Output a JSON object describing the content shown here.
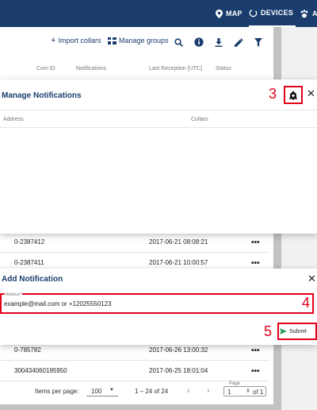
{
  "nav": {
    "map_label": "MAP",
    "devices_label": "DEVICES",
    "partial_label": "A"
  },
  "toolbar": {
    "import_label": "Import collars",
    "manage_groups_label": "Manage groups"
  },
  "table": {
    "columns": [
      "Com ID",
      "Notifications",
      "Last Reception [UTC]",
      "Status"
    ],
    "rows": [
      {
        "com_id": "0-2387412",
        "last_reception": "2017-06-21 08:08:21"
      },
      {
        "com_id": "0-2387411",
        "last_reception": "2017-06-21 10:00:57"
      },
      {
        "com_id": "0-785782",
        "last_reception": "2017-06-26 13:00:32"
      },
      {
        "com_id": "300434060195950",
        "last_reception": "2017-06-25 18:01:04"
      }
    ],
    "row_menu": "•••"
  },
  "pager": {
    "items_label": "Items per page:",
    "items_value": "100",
    "range": "1 – 24 of 24",
    "page_label": "Page",
    "page_value": "1",
    "of_label": "of 1"
  },
  "manage_dialog": {
    "title": "Manage Notifications",
    "col_address": "Address",
    "col_collars": "Collars"
  },
  "add_dialog": {
    "title": "Add Notification",
    "field_label": "Address*",
    "field_value": "example@mail.com or +12025550123",
    "submit_label": "Submit"
  },
  "callouts": {
    "n3": "3",
    "n4": "4",
    "n5": "5"
  },
  "colors": {
    "nav_bg": "#1b3d6e",
    "annotation_red": "#e3001b",
    "accent_blue": "#1b3d6e",
    "submit_green": "#2a9d5c"
  }
}
